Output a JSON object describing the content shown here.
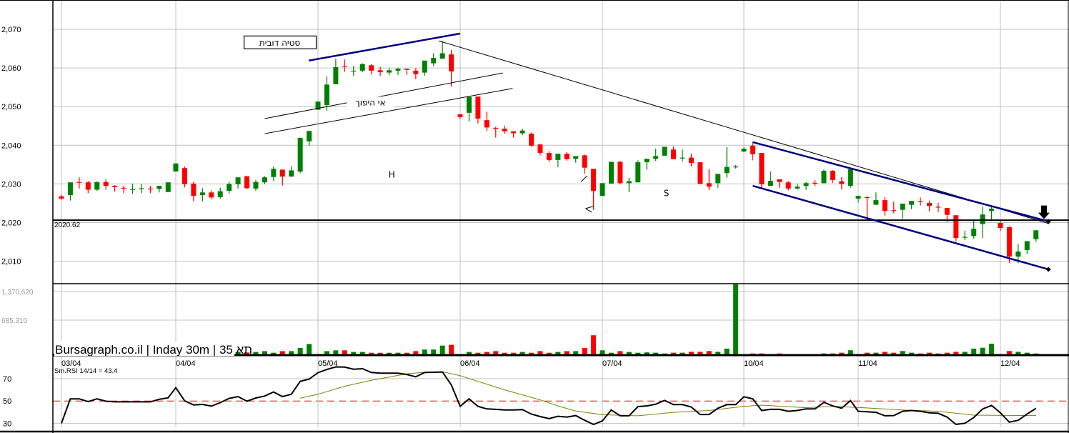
{
  "chart_data": {
    "type": "candlestick",
    "title": "Bursagraph.co.il | Inday 30m | 35 תא",
    "colors": {
      "up": "#008000",
      "down": "#ff0000",
      "grid": "#c0c0c0",
      "trend_blue": "#000080",
      "rsi": "#000000",
      "rsi_signal": "#808000",
      "rsi_mid": "#ff0000"
    },
    "price_axis": {
      "ticks": [
        2070,
        2060,
        2050,
        2040,
        2030,
        2020,
        2010
      ],
      "tick_labels": [
        "2,070",
        "2,060",
        "2,050",
        "2,040",
        "2,030",
        "2,020",
        "2,010"
      ],
      "range": [
        2004.5,
        2077.5
      ]
    },
    "volume_axis": {
      "tick_labels": [
        "1,370,620",
        "685,310"
      ],
      "ticks": [
        1370620,
        685310
      ]
    },
    "rsi_axis": {
      "ticks": [
        70,
        50,
        30
      ],
      "tick_labels": [
        "70",
        "50",
        "30"
      ],
      "range": [
        25,
        82
      ]
    },
    "days": [
      {
        "label": "03/04",
        "start": 0
      },
      {
        "label": "04/04",
        "start": 13
      },
      {
        "label": "05/04",
        "start": 29
      },
      {
        "label": "06/04",
        "start": 45
      },
      {
        "label": "07/04",
        "start": 61
      },
      {
        "label": "10/04",
        "start": 77
      },
      {
        "label": "11/04",
        "start": 90
      },
      {
        "label": "12/04",
        "start": 106
      }
    ],
    "ohlc_fields": [
      "open",
      "high",
      "low",
      "close"
    ],
    "ohlc": [
      [
        2026.8,
        2027.2,
        2025.9,
        2026.2
      ],
      [
        2027.1,
        2030.4,
        2025.7,
        2030.4
      ],
      [
        2030.5,
        2031.7,
        2028.8,
        2030.4
      ],
      [
        2030.4,
        2030.8,
        2027.6,
        2028.5
      ],
      [
        2028.5,
        2030.6,
        2028.2,
        2030.5
      ],
      [
        2030.5,
        2031.2,
        2028.5,
        2029.5
      ],
      [
        2029.5,
        2029.7,
        2028.0,
        2029.2
      ],
      [
        2029.0,
        2029.5,
        2027.6,
        2028.8
      ],
      [
        2028.6,
        2030.1,
        2027.4,
        2028.7
      ],
      [
        2028.8,
        2030.0,
        2027.6,
        2028.9
      ],
      [
        2028.8,
        2029.5,
        2027.6,
        2028.6
      ],
      [
        2028.7,
        2029.5,
        2027.8,
        2029.5
      ],
      [
        2027.9,
        2030.4,
        2027.9,
        2030.4
      ],
      [
        2033.2,
        2035.3,
        2033.2,
        2035.3
      ],
      [
        2034.1,
        2034.5,
        2029.1,
        2029.9
      ],
      [
        2030.1,
        2030.6,
        2025.5,
        2026.9
      ],
      [
        2027.1,
        2028.9,
        2025.5,
        2027.8
      ],
      [
        2027.8,
        2028.3,
        2026.0,
        2026.5
      ],
      [
        2026.6,
        2029.0,
        2026.2,
        2028.1
      ],
      [
        2028.2,
        2030.6,
        2027.5,
        2030.0
      ],
      [
        2029.9,
        2031.7,
        2028.8,
        2031.7
      ],
      [
        2032.0,
        2032.0,
        2028.6,
        2028.9
      ],
      [
        2028.8,
        2031.0,
        2028.2,
        2030.5
      ],
      [
        2030.4,
        2032.0,
        2029.9,
        2031.7
      ],
      [
        2031.8,
        2034.5,
        2030.8,
        2033.9
      ],
      [
        2033.7,
        2033.7,
        2029.6,
        2031.9
      ],
      [
        2031.9,
        2034.6,
        2031.9,
        2033.5
      ],
      [
        2033.2,
        2042.0,
        2032.8,
        2041.9
      ],
      [
        2041.0,
        2043.7,
        2039.8,
        2043.7
      ],
      [
        2049.2,
        2051.3,
        2049.2,
        2051.3
      ],
      [
        2050.4,
        2057.8,
        2048.9,
        2055.7
      ],
      [
        2055.8,
        2062.3,
        2055.8,
        2060.2
      ],
      [
        2060.5,
        2062.2,
        2059.0,
        2060.4
      ],
      [
        2059.2,
        2060.5,
        2058.0,
        2059.3
      ],
      [
        2059.3,
        2061.2,
        2058.9,
        2061.0
      ],
      [
        2060.7,
        2061.0,
        2058.3,
        2059.3
      ],
      [
        2059.4,
        2060.3,
        2057.9,
        2058.9
      ],
      [
        2058.8,
        2060.0,
        2058.1,
        2059.4
      ],
      [
        2059.3,
        2060.0,
        2058.2,
        2059.8
      ],
      [
        2059.8,
        2059.8,
        2058.2,
        2059.5
      ],
      [
        2059.3,
        2059.9,
        2057.1,
        2058.4
      ],
      [
        2058.8,
        2061.9,
        2058.0,
        2061.9
      ],
      [
        2061.2,
        2063.8,
        2060.5,
        2062.6
      ],
      [
        2062.4,
        2067.0,
        2062.4,
        2063.8
      ],
      [
        2063.5,
        2064.7,
        2055.2,
        2059.1
      ],
      [
        2048.0,
        2048.0,
        2046.8,
        2047.3
      ],
      [
        2048.4,
        2052.5,
        2046.2,
        2052.5
      ],
      [
        2052.6,
        2052.6,
        2045.6,
        2046.9
      ],
      [
        2046.5,
        2048.7,
        2043.7,
        2044.6
      ],
      [
        2044.5,
        2044.8,
        2042.0,
        2044.4
      ],
      [
        2044.3,
        2045.1,
        2043.0,
        2043.6
      ],
      [
        2043.6,
        2043.6,
        2042.0,
        2043.1
      ],
      [
        2043.1,
        2044.3,
        2042.6,
        2043.8
      ],
      [
        2043.0,
        2043.3,
        2039.6,
        2039.9
      ],
      [
        2040.2,
        2040.4,
        2037.4,
        2038.0
      ],
      [
        2038.0,
        2038.5,
        2035.7,
        2036.2
      ],
      [
        2036.2,
        2037.8,
        2034.3,
        2037.8
      ],
      [
        2037.8,
        2038.2,
        2036.0,
        2036.4
      ],
      [
        2036.5,
        2037.2,
        2035.5,
        2037.2
      ],
      [
        2037.4,
        2037.6,
        2032.6,
        2034.2
      ],
      [
        2033.9,
        2033.9,
        2023.3,
        2028.2
      ],
      [
        2026.9,
        2030.2,
        2026.9,
        2030.2
      ],
      [
        2030.1,
        2035.7,
        2030.1,
        2035.7
      ],
      [
        2035.7,
        2036.0,
        2029.9,
        2030.2
      ],
      [
        2030.2,
        2031.6,
        2027.9,
        2030.7
      ],
      [
        2030.4,
        2036.1,
        2030.4,
        2035.6
      ],
      [
        2035.6,
        2036.5,
        2033.7,
        2036.5
      ],
      [
        2036.5,
        2039.1,
        2035.9,
        2037.2
      ],
      [
        2037.3,
        2039.6,
        2037.3,
        2039.6
      ],
      [
        2038.9,
        2039.7,
        2036.4,
        2036.4
      ],
      [
        2036.7,
        2038.9,
        2035.8,
        2036.8
      ],
      [
        2036.8,
        2037.8,
        2034.5,
        2035.4
      ],
      [
        2035.6,
        2035.6,
        2030.0,
        2030.0
      ],
      [
        2030.2,
        2033.8,
        2028.4,
        2029.3
      ],
      [
        2030.2,
        2032.6,
        2029.0,
        2032.6
      ],
      [
        2032.8,
        2039.5,
        2031.6,
        2034.4
      ],
      [
        2034.4,
        2034.9,
        2034.0,
        2034.5
      ],
      [
        2038.4,
        2039.4,
        2038.2,
        2039.1
      ],
      [
        2039.9,
        2040.8,
        2036.1,
        2037.7
      ],
      [
        2038.0,
        2038.0,
        2029.0,
        2029.9
      ],
      [
        2029.5,
        2033.2,
        2029.5,
        2030.8
      ],
      [
        2031.2,
        2031.2,
        2029.0,
        2030.5
      ],
      [
        2030.4,
        2030.7,
        2028.3,
        2028.8
      ],
      [
        2028.8,
        2030.1,
        2028.5,
        2029.3
      ],
      [
        2029.5,
        2030.5,
        2028.5,
        2030.2
      ],
      [
        2030.3,
        2031.0,
        2029.4,
        2030.2
      ],
      [
        2030.2,
        2033.7,
        2030.2,
        2033.4
      ],
      [
        2033.4,
        2033.6,
        2030.2,
        2031.0
      ],
      [
        2030.7,
        2031.8,
        2028.6,
        2030.0
      ],
      [
        2029.5,
        2033.8,
        2029.0,
        2033.8
      ],
      [
        2026.2,
        2026.9,
        2025.2,
        2026.9
      ],
      [
        2026.6,
        2026.8,
        2020.7,
        2026.4
      ],
      [
        2024.6,
        2027.8,
        2024.6,
        2025.8
      ],
      [
        2025.8,
        2026.6,
        2021.8,
        2023.0
      ],
      [
        2023.2,
        2025.4,
        2022.4,
        2023.1
      ],
      [
        2023.3,
        2024.9,
        2021.0,
        2024.9
      ],
      [
        2024.6,
        2025.6,
        2023.5,
        2025.6
      ],
      [
        2025.5,
        2026.5,
        2024.4,
        2025.4
      ],
      [
        2025.1,
        2025.7,
        2022.9,
        2024.3
      ],
      [
        2024.1,
        2025.1,
        2022.7,
        2024.0
      ],
      [
        2023.8,
        2023.8,
        2020.2,
        2022.0
      ],
      [
        2021.9,
        2021.9,
        2015.1,
        2016.0
      ],
      [
        2016.2,
        2017.9,
        2015.5,
        2016.3
      ],
      [
        2016.5,
        2020.8,
        2015.8,
        2018.4
      ],
      [
        2019.6,
        2024.2,
        2016.0,
        2022.1
      ],
      [
        2023.0,
        2024.2,
        2020.4,
        2023.6
      ],
      [
        2019.9,
        2020.7,
        2017.8,
        2018.6
      ],
      [
        2018.8,
        2019.0,
        2009.6,
        2011.2
      ],
      [
        2011.2,
        2014.5,
        2009.5,
        2012.5
      ],
      [
        2012.9,
        2015.2,
        2011.9,
        2015.2
      ],
      [
        2015.7,
        2018.0,
        2015.0,
        2018.0
      ]
    ],
    "volumes_thousands": [
      null,
      null,
      null,
      null,
      null,
      null,
      null,
      null,
      null,
      null,
      null,
      null,
      null,
      null,
      null,
      null,
      null,
      null,
      null,
      null,
      68,
      57,
      68,
      86,
      51,
      86,
      86,
      154,
      240,
      17,
      86,
      103,
      103,
      68,
      68,
      51,
      51,
      51,
      51,
      51,
      86,
      120,
      120,
      205,
      222,
      17,
      68,
      51,
      68,
      86,
      51,
      51,
      68,
      51,
      86,
      51,
      68,
      86,
      86,
      154,
      428,
      103,
      51,
      86,
      68,
      51,
      59,
      52,
      35,
      52,
      52,
      71,
      71,
      88,
      71,
      140,
      1525,
      17,
      35,
      35,
      17,
      35,
      17,
      17,
      17,
      17,
      35,
      35,
      52,
      105,
      17,
      52,
      52,
      71,
      52,
      88,
      52,
      35,
      52,
      35,
      52,
      71,
      71,
      140,
      159,
      246,
      17,
      88,
      71,
      52,
      35
    ],
    "rsi": {
      "label": "Sm.RSI 14/14 = 43.4",
      "values": [
        30,
        51.9,
        51.9,
        49.4,
        51.9,
        49.8,
        49.2,
        49.2,
        49.2,
        49.2,
        49.2,
        51.5,
        52.9,
        61.9,
        50.2,
        46.5,
        46.9,
        45.4,
        48.5,
        52.3,
        54,
        49.8,
        52.7,
        54.4,
        58.1,
        54,
        56,
        67.7,
        69.6,
        75.4,
        78.3,
        80.6,
        80.4,
        78.5,
        79,
        75.6,
        75,
        75,
        75,
        73.8,
        71.7,
        75.6,
        75.8,
        76,
        64.4,
        45.2,
        51.9,
        45.2,
        42.9,
        42.5,
        41.9,
        41.9,
        42.3,
        38.3,
        36,
        34.2,
        36.3,
        35.6,
        36.9,
        32.7,
        29,
        32.1,
        41.9,
        36.7,
        36.7,
        45,
        45.6,
        47.1,
        50.6,
        46.7,
        46.7,
        44.6,
        37.9,
        37.9,
        43.5,
        46.7,
        46.7,
        53.8,
        51.9,
        41.5,
        42.5,
        42.5,
        40.8,
        41.5,
        42.9,
        42.9,
        48.8,
        45.6,
        43.5,
        50.4,
        40.8,
        40.4,
        39.8,
        36.7,
        36.9,
        40.8,
        41.5,
        40.8,
        39.4,
        39,
        35.6,
        29,
        30,
        35.2,
        42.9,
        46,
        39.4,
        31,
        32.7,
        38.3,
        43.4
      ],
      "signal": [
        [
          27,
          52.5
        ],
        [
          29,
          56
        ],
        [
          32,
          63.3
        ],
        [
          35,
          68.5
        ],
        [
          39,
          74.4
        ],
        [
          41,
          75.8
        ],
        [
          43,
          76.2
        ],
        [
          45,
          72.7
        ],
        [
          50,
          60
        ],
        [
          54,
          51
        ],
        [
          56,
          45.6
        ],
        [
          58,
          41
        ],
        [
          61,
          37.7
        ],
        [
          65,
          36.7
        ],
        [
          69,
          39.8
        ],
        [
          73,
          41.5
        ],
        [
          77,
          45.2
        ],
        [
          79,
          46.3
        ],
        [
          84,
          44
        ],
        [
          87,
          45.2
        ],
        [
          90,
          44.2
        ],
        [
          95,
          41.9
        ],
        [
          99,
          40.8
        ],
        [
          103,
          37.3
        ],
        [
          110,
          36.9
        ]
      ]
    },
    "horizontal_line": {
      "value": 2020.62,
      "label": "2020.62"
    },
    "trendlines": [
      {
        "name": "upper-wedge-line",
        "color": "blue",
        "from": [
          27.95,
          2061.9
        ],
        "to": [
          45.0,
          2068.9
        ]
      },
      {
        "name": "long-downtrend-line",
        "color": "black",
        "from": [
          42.6,
          2067.0
        ],
        "to": [
          111.5,
          2019.7
        ]
      },
      {
        "name": "parallel-line-1",
        "color": "black",
        "from": [
          23.0,
          2046.9
        ],
        "to": [
          49.8,
          2058.7
        ]
      },
      {
        "name": "parallel-line-2",
        "color": "black",
        "from": [
          23.0,
          2043.0
        ],
        "to": [
          50.9,
          2054.7
        ]
      },
      {
        "name": "channel-upper-line",
        "color": "blue",
        "from": [
          78.0,
          2040.8
        ],
        "to": [
          111.4,
          2020.3
        ]
      },
      {
        "name": "channel-lower-line",
        "color": "blue",
        "from": [
          78.0,
          2029.5
        ],
        "to": [
          111.4,
          2007.9
        ]
      },
      {
        "name": "mark-slash",
        "color": "black",
        "from": [
          58.6,
          2030.6
        ],
        "to": [
          59.3,
          2032.1
        ]
      },
      {
        "name": "mark-angle-a",
        "color": "black",
        "from": [
          59.95,
          2024.2
        ],
        "to": [
          59.1,
          2023.6
        ]
      },
      {
        "name": "mark-angle-b",
        "color": "black",
        "from": [
          59.1,
          2023.6
        ],
        "to": [
          59.8,
          2022.7
        ]
      }
    ],
    "annotations": [
      {
        "text": "סטיה דובית",
        "at": [
          24.7,
          2066.6
        ],
        "boxed": true
      },
      {
        "text": "אי היפוך",
        "at": [
          34.9,
          2051.1
        ],
        "boxed": false
      },
      {
        "text": "H",
        "at": [
          37.3,
          2032.5
        ],
        "boxed": false
      },
      {
        "text": "S",
        "at": [
          68.2,
          2027.7
        ],
        "boxed": false
      }
    ],
    "arrow": {
      "direction": "down",
      "at": [
        110.9,
        2020.9
      ]
    }
  }
}
